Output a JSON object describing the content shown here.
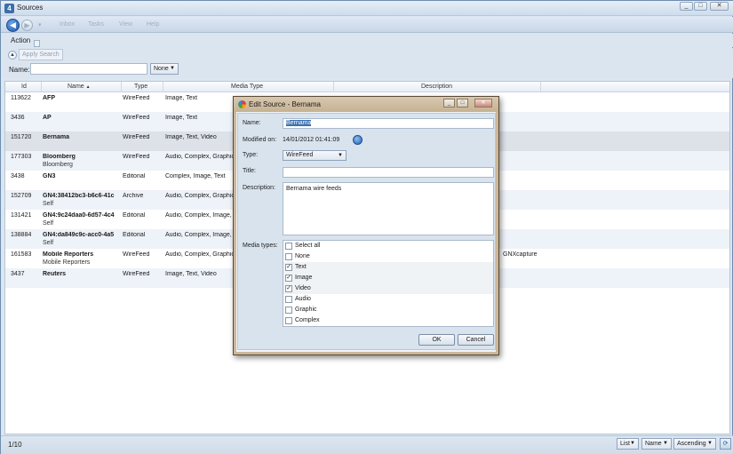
{
  "window": {
    "title": "Sources",
    "app_icon": "grid-icon",
    "controls": [
      "minimize-icon",
      "maximize-icon",
      "close-icon"
    ]
  },
  "menu": {
    "items": [
      "Inbox",
      "Tasks",
      "View",
      "Help"
    ]
  },
  "actionbar": {
    "label": "Action"
  },
  "search": {
    "apply_label": "Apply Search",
    "name_label": "Name:",
    "name_value": "",
    "filter_value": "None"
  },
  "grid": {
    "headers": {
      "id": "Id",
      "name": "Name",
      "type": "Type",
      "media": "Media Type",
      "description": "Description"
    },
    "sort_indicator": "▲",
    "rows": [
      {
        "id": "113622",
        "name": "AFP",
        "sub": "",
        "type": "WireFeed",
        "media": "Image, Text",
        "desc": ""
      },
      {
        "id": "3436",
        "name": "AP",
        "sub": "",
        "type": "WireFeed",
        "media": "Image, Text",
        "desc": ""
      },
      {
        "id": "151720",
        "name": "Bernama",
        "sub": "",
        "type": "WireFeed",
        "media": "Image, Text, Video",
        "desc": ""
      },
      {
        "id": "177303",
        "name": "Bloomberg",
        "sub": "Bloomberg",
        "type": "WireFeed",
        "media": "Audio, Complex, Graphic",
        "desc": ""
      },
      {
        "id": "3438",
        "name": "GN3",
        "sub": "",
        "type": "Editorial",
        "media": "Complex, Image, Text",
        "desc": ""
      },
      {
        "id": "152709",
        "name": "GN4:38412bc3-b6c6-41c",
        "sub": "Self",
        "type": "Archive",
        "media": "Audio, Complex, Graphic",
        "desc": ""
      },
      {
        "id": "131421",
        "name": "GN4:9c24daa0-6d57-4c4",
        "sub": "Self",
        "type": "Editorial",
        "media": "Audio, Complex, Image,",
        "desc": ""
      },
      {
        "id": "138884",
        "name": "GN4:da849c9c-acc0-4a5",
        "sub": "Self",
        "type": "Editorial",
        "media": "Audio, Complex, Image,",
        "desc": ""
      },
      {
        "id": "161583",
        "name": "Mobile Reporters",
        "sub": "Mobile Reporters",
        "type": "WireFeed",
        "media": "Audio, Complex, Graphic",
        "desc": "GNXcapture"
      },
      {
        "id": "3437",
        "name": "Reuters",
        "sub": "",
        "type": "WireFeed",
        "media": "Image, Text, Video",
        "desc": ""
      }
    ]
  },
  "status": {
    "text": "1/10",
    "view": "List",
    "sort_field": "Name",
    "sort_order": "Ascending"
  },
  "dialog": {
    "title": "Edit Source - Bernama",
    "name_label": "Name:",
    "name_value": "Bernama",
    "modified_label": "Modified on:",
    "modified_value": "14/01/2012   01:41:09",
    "type_label": "Type:",
    "type_value": "WireFeed",
    "title_label": "Title:",
    "title_value": "",
    "desc_label": "Description:",
    "desc_value": "Bernama wire feeds",
    "media_label": "Media types:",
    "media_types": [
      {
        "label": "Select all",
        "checked": false
      },
      {
        "label": "None",
        "checked": false
      },
      {
        "label": "Text",
        "checked": true
      },
      {
        "label": "Image",
        "checked": true
      },
      {
        "label": "Video",
        "checked": true
      },
      {
        "label": "Audio",
        "checked": false
      },
      {
        "label": "Graphic",
        "checked": false
      },
      {
        "label": "Complex",
        "checked": false
      }
    ],
    "ok_label": "OK",
    "cancel_label": "Cancel"
  }
}
